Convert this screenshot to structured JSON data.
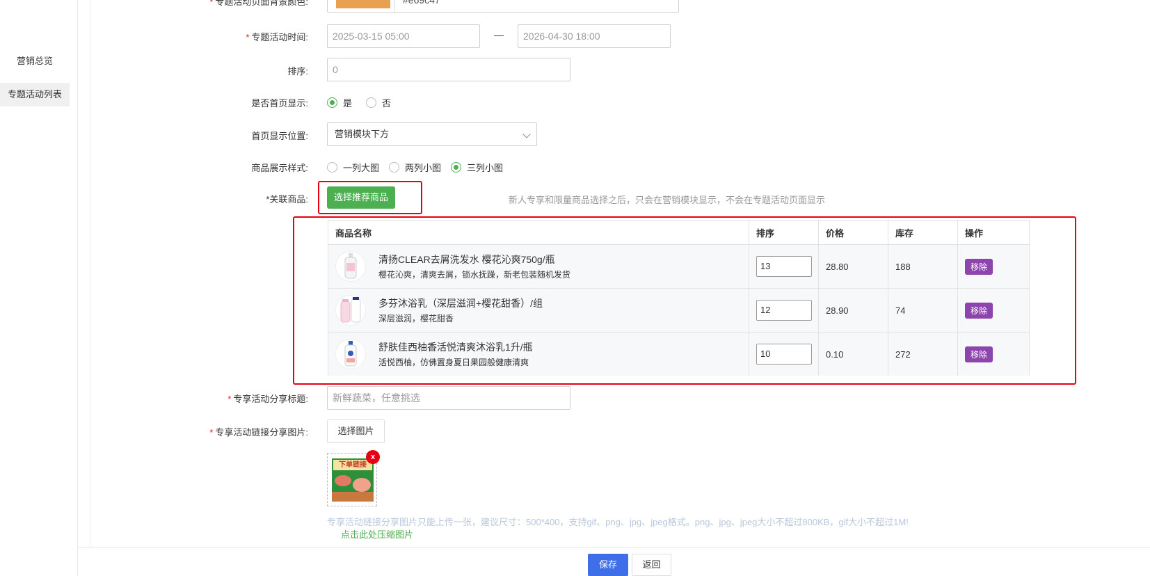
{
  "sidebar": {
    "items": [
      {
        "label": "营销总览"
      },
      {
        "label": "专题活动列表"
      }
    ]
  },
  "form": {
    "bg_color": {
      "label": "专题活动页面背景颜色:",
      "value": "#e69c47",
      "swatch_color": "#e8a24f"
    },
    "time": {
      "label": "专题活动时间:",
      "start": "2025-03-15 05:00",
      "separator": "—",
      "end": "2026-04-30 18:00"
    },
    "sort": {
      "label": "排序:",
      "placeholder": "0"
    },
    "show_home": {
      "label": "是否首页显示:",
      "options": [
        "是",
        "否"
      ],
      "selected": "是"
    },
    "home_position": {
      "label": "首页显示位置:",
      "value": "营销模块下方"
    },
    "display_style": {
      "label": "商品展示样式:",
      "options": [
        "一列大图",
        "两列小图",
        "三列小图"
      ],
      "selected": "三列小图"
    },
    "related": {
      "label": "*关联商品:",
      "button": "选择推荐商品",
      "hint": "新人专享和限量商品选择之后，只会在营销模块显示，不会在专题活动页面显示"
    },
    "table": {
      "headers": [
        "商品名称",
        "排序",
        "价格",
        "库存",
        "操作"
      ],
      "rows": [
        {
          "name": "清扬CLEAR去屑洗发水 樱花沁爽750g/瓶",
          "desc": "樱花沁爽，清爽去屑，锁水抚躁，新老包装随机发货",
          "sort": "13",
          "price": "28.80",
          "stock": "188",
          "action": "移除"
        },
        {
          "name": "多芬沐浴乳（深层滋润+樱花甜香）/组",
          "desc": "深层滋润，樱花甜香",
          "sort": "12",
          "price": "28.90",
          "stock": "74",
          "action": "移除"
        },
        {
          "name": "舒肤佳西柚香活悦清爽沐浴乳1升/瓶",
          "desc": "活悦西柚，仿佛置身夏日果园般健康清爽",
          "sort": "10",
          "price": "0.10",
          "stock": "272",
          "action": "移除"
        }
      ]
    },
    "share_title": {
      "label": "专享活动分享标题:",
      "placeholder": "新鲜蔬菜，任意挑选"
    },
    "share_image": {
      "label": "专享活动链接分享图片:",
      "button": "选择图片",
      "thumb_text": "下单链接",
      "delete": "x",
      "tip": "专享活动链接分享图片只能上传一张，建议尺寸：500*400，支持gif、png、jpg、jpeg格式。png、jpg、jpeg大小不超过800KB，gif大小不超过1M!",
      "compress_link": "点击此处压缩图片"
    }
  },
  "footer": {
    "save": "保存",
    "back": "返回"
  }
}
